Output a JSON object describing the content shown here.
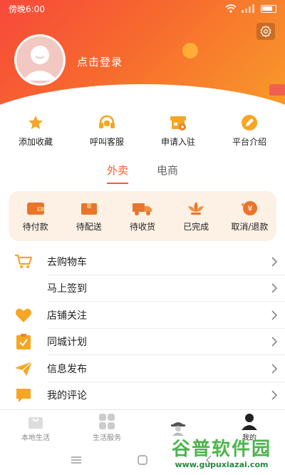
{
  "status_bar": {
    "time": "傍晚6:00"
  },
  "profile": {
    "login_text": "点击登录"
  },
  "quick_actions": [
    {
      "label": "添加收藏",
      "icon": "star-icon"
    },
    {
      "label": "呼叫客服",
      "icon": "headset-icon"
    },
    {
      "label": "申请入驻",
      "icon": "store-icon"
    },
    {
      "label": "平台介绍",
      "icon": "pen-icon"
    }
  ],
  "tabs": [
    {
      "label": "外卖",
      "active": true
    },
    {
      "label": "电商",
      "active": false
    }
  ],
  "orders": [
    {
      "label": "待付款",
      "icon": "wallet-icon"
    },
    {
      "label": "待配送",
      "icon": "box-icon"
    },
    {
      "label": "待收货",
      "icon": "truck-icon"
    },
    {
      "label": "已完成",
      "icon": "lotus-icon"
    },
    {
      "label": "取消/退款",
      "icon": "refund-icon"
    }
  ],
  "menu": [
    {
      "label": "去购物车",
      "icon": "cart-icon"
    },
    {
      "label": "马上签到",
      "icon": ""
    },
    {
      "label": "店铺关注",
      "icon": "heart-icon"
    },
    {
      "label": "同城计划",
      "icon": "checklist-icon"
    },
    {
      "label": "信息发布",
      "icon": "paper-plane-icon"
    },
    {
      "label": "我的评论",
      "icon": "comment-icon"
    }
  ],
  "bottom_nav": [
    {
      "label": "本地生活",
      "icon": "bag-icon"
    },
    {
      "label": "生活服务",
      "icon": "grid-icon"
    },
    {
      "label": "",
      "icon": "courier-icon"
    },
    {
      "label": "我的",
      "icon": "person-icon",
      "active": true
    }
  ],
  "watermark": {
    "title": "谷普软件园",
    "url": "www.gupuxiazai.com"
  },
  "colors": {
    "accent": "#ff5a2e",
    "icon_orange": "#f6a623",
    "header_start": "#f7493a",
    "header_end": "#f99a2a",
    "orders_bg": "#fdf1e6"
  }
}
